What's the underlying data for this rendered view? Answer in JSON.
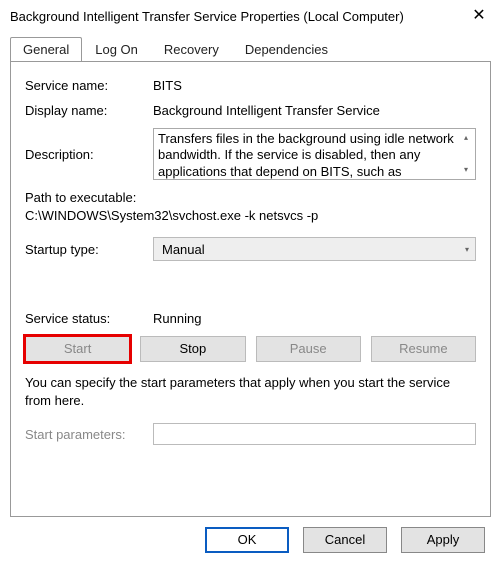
{
  "window": {
    "title": "Background Intelligent Transfer Service Properties (Local Computer)"
  },
  "tabs": {
    "general": "General",
    "logon": "Log On",
    "recovery": "Recovery",
    "dependencies": "Dependencies",
    "active": "General"
  },
  "labels": {
    "service_name": "Service name:",
    "display_name": "Display name:",
    "description": "Description:",
    "path": "Path to executable:",
    "startup_type": "Startup type:",
    "service_status": "Service status:",
    "start_parameters": "Start parameters:"
  },
  "values": {
    "service_name": "BITS",
    "display_name": "Background Intelligent Transfer Service",
    "description": "Transfers files in the background using idle network bandwidth. If the service is disabled, then any applications that depend on BITS, such as Windows",
    "path": "C:\\WINDOWS\\System32\\svchost.exe -k netsvcs -p",
    "startup_type": "Manual",
    "service_status": "Running",
    "start_parameters": ""
  },
  "buttons": {
    "start": "Start",
    "stop": "Stop",
    "pause": "Pause",
    "resume": "Resume"
  },
  "hint": "You can specify the start parameters that apply when you start the service from here.",
  "footer": {
    "ok": "OK",
    "cancel": "Cancel",
    "apply": "Apply"
  }
}
